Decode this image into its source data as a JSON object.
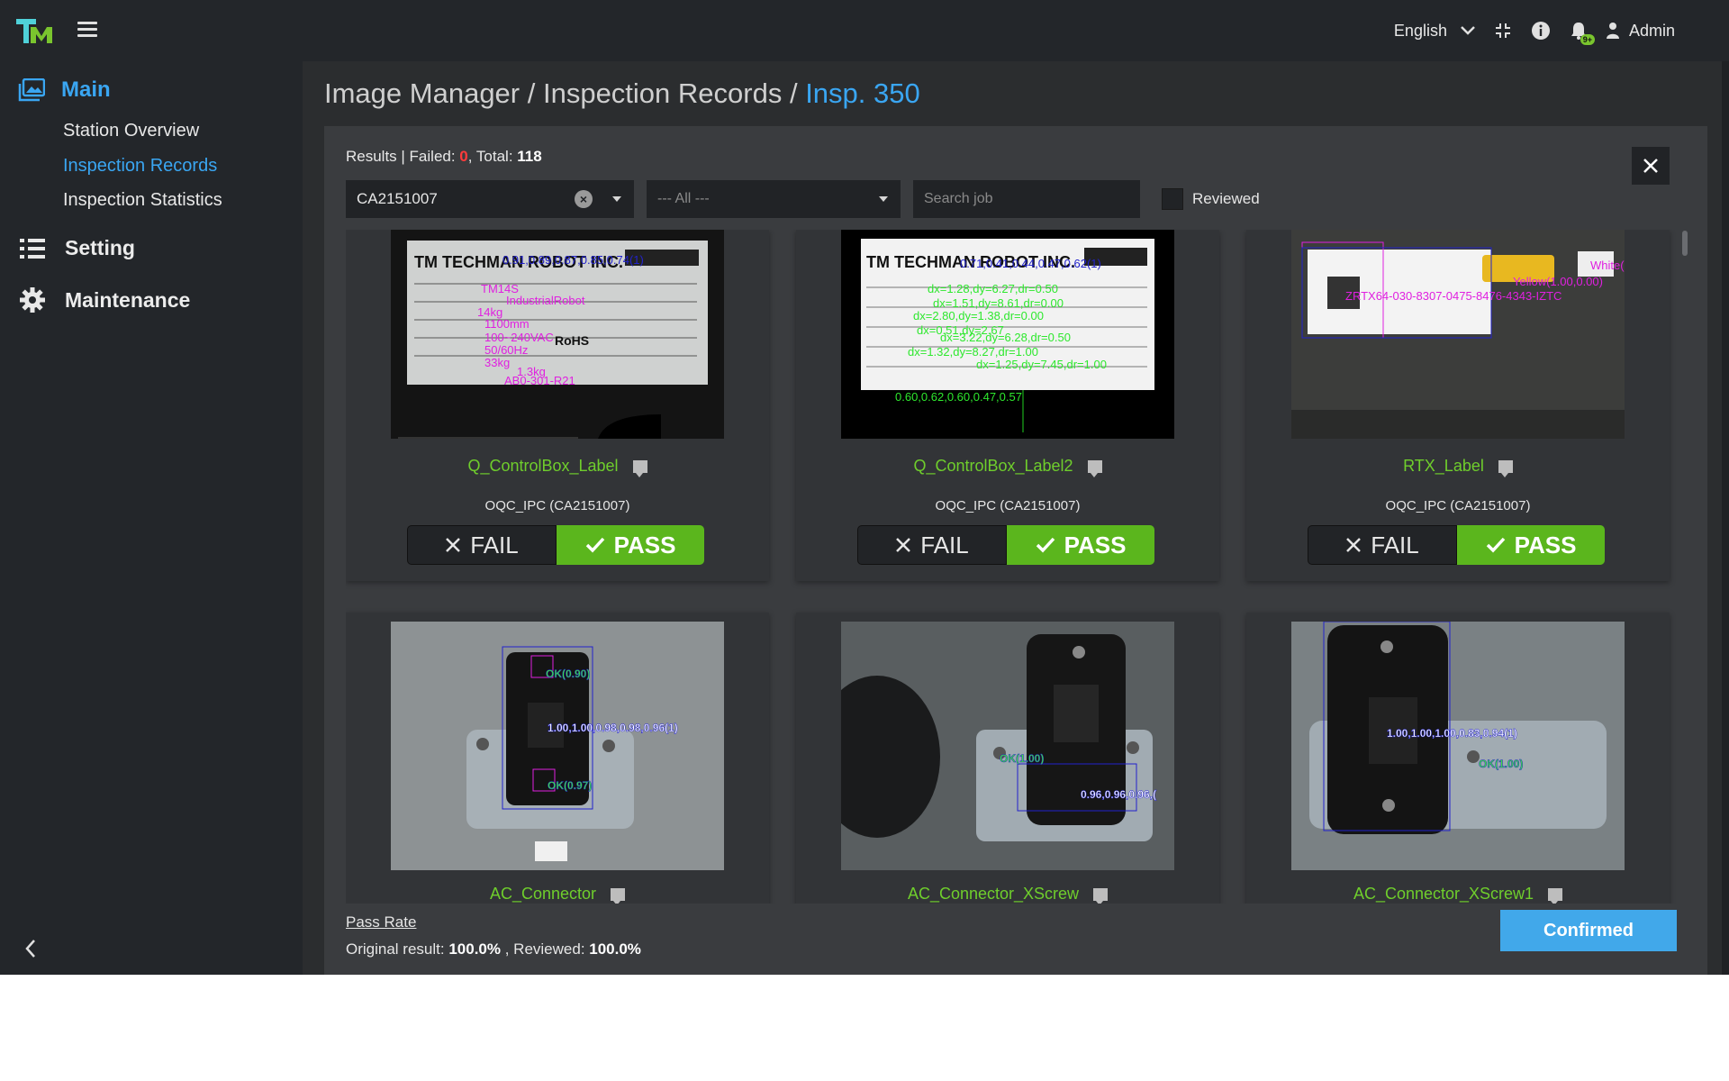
{
  "topbar": {
    "language": "English",
    "notification_badge": "9+",
    "user": "Admin",
    "icons": [
      "logo",
      "menu-icon",
      "chevron-down-icon",
      "compress-icon",
      "info-icon",
      "bell-icon",
      "user-icon"
    ]
  },
  "sidebar": {
    "main_label": "Main",
    "main_items": [
      "Station Overview",
      "Inspection Records",
      "Inspection Statistics"
    ],
    "setting_label": "Setting",
    "maintenance_label": "Maintenance"
  },
  "breadcrumb": {
    "part1": "Image Manager",
    "sep": " / ",
    "part2": "Inspection Records",
    "current": "Insp. 350"
  },
  "results": {
    "prefix": "Results | Failed: ",
    "failed": "0",
    "total_label": ", Total: ",
    "total": "118"
  },
  "filters": {
    "job_value": "CA2151007",
    "status_value": "--- All ---",
    "search_placeholder": "Search job",
    "reviewed_label": "Reviewed"
  },
  "cards": [
    {
      "name": "Q_ControlBox_Label",
      "station": "OQC_IPC (CA2151007)",
      "fail": "FAIL",
      "pass": "PASS"
    },
    {
      "name": "Q_ControlBox_Label2",
      "station": "OQC_IPC (CA2151007)",
      "fail": "FAIL",
      "pass": "PASS"
    },
    {
      "name": "RTX_Label",
      "station": "OQC_IPC (CA2151007)",
      "fail": "FAIL",
      "pass": "PASS"
    },
    {
      "name": "AC_Connector"
    },
    {
      "name": "AC_Connector_XScrew"
    },
    {
      "name": "AC_Connector_XScrew1"
    }
  ],
  "overlays": {
    "label1_line1": "0.91,0.89,0.87,0.85,0.74(1)",
    "label1_items": [
      "TM14S",
      "IndustrialRobot",
      "14kg",
      "1100mm",
      "100~240VAC",
      "50/60Hz",
      "33kg",
      "1.3kg",
      "AB0-301-R21"
    ],
    "label2_line1": "0.71,0.41,0.44,0.47,0.62(1)",
    "label2_items": [
      "dx=1.28,dy=6.27,dr=0.50",
      "dx=1.51,dy=8.61,dr=0.00",
      "dx=2.80,dy=1.38,dr=0.00",
      "dx=0.51,dy=2.67",
      "dx=3.22,dy=6.28,dr=0.50",
      "dx=1.32,dy=8.27,dr=1.00",
      "dx=1.25,dy=7.45,dr=1.00",
      "0.60,0.62,0.60,0.47,0.57"
    ],
    "label3_line1": "ZRTX64-030-8307-0475-8476-4343-IZTC",
    "label3_line2": "Yellow(1.00,0.00)",
    "label3_line3": "White(",
    "conn1": [
      "OK(0.90)",
      "1.00,1.00,0.98,0.98,0.96(1)",
      "OK(0.97)"
    ],
    "conn2": [
      "OK(1.00)",
      "0.96,0.96,0.96,("
    ],
    "conn3": [
      "1.00,1.00,1.00,0.83,0.94(1)",
      "OK(1.00)"
    ]
  },
  "footer": {
    "pass_rate_label": "Pass Rate",
    "original_label": "Original result: ",
    "original_value": "100.0%",
    "reviewed_label": " , Reviewed: ",
    "reviewed_value": "100.0%",
    "confirm_label": "Confirmed"
  },
  "colors": {
    "accent": "#3aa6f2",
    "pass": "#5bb61d",
    "fail_count": "#ff3b3b",
    "card_name": "#6fce2c"
  }
}
